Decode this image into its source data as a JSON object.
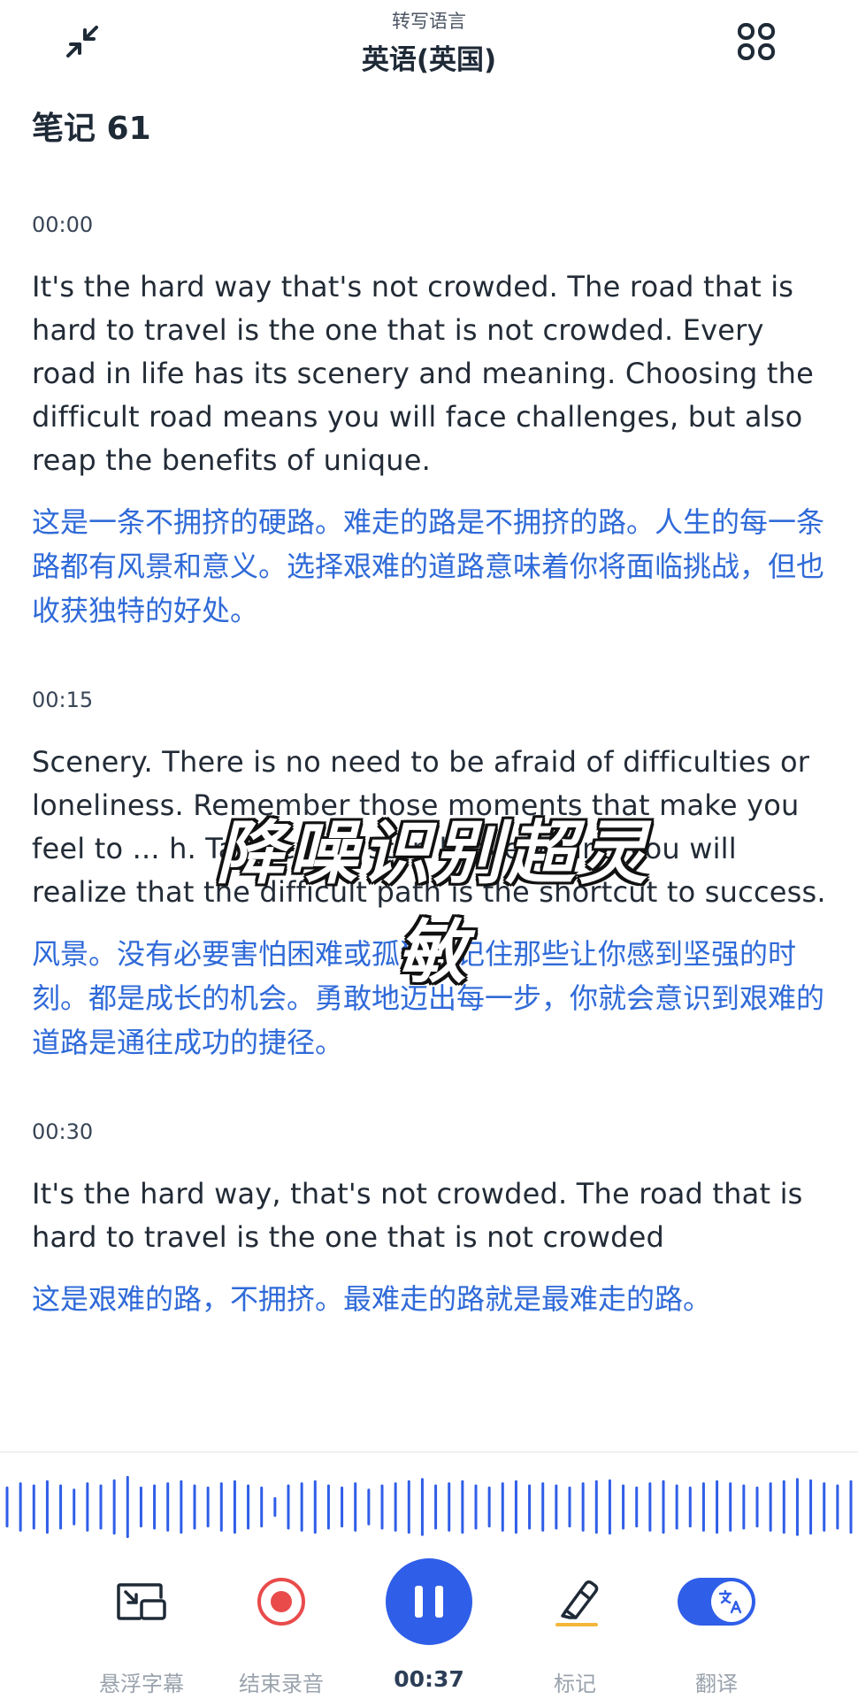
{
  "header": {
    "subtitle": "转写语言",
    "language": "英语(英国)"
  },
  "note": {
    "title": "笔记 61"
  },
  "segments": [
    {
      "time": "00:00",
      "en": "It's the hard way that's not crowded. The road that is hard to travel is the one that is not crowded. Every road in life has its scenery and meaning. Choosing the difficult road means you will face challenges, but also reap the benefits of unique.",
      "zh": "这是一条不拥挤的硬路。难走的路是不拥挤的路。人生的每一条路都有风景和意义。选择艰难的道路意味着你将面临挑战，但也收获独特的好处。"
    },
    {
      "time": "00:15",
      "en": "Scenery. There is no need to be afraid of difficulties or loneliness. Remember those moments that make you feel to ... h. Take every step bravely, and you will realize that the difficult path is the shortcut to success.",
      "zh": "风景。没有必要害怕困难或孤独。记住那些让你感到坚强的时刻。都是成长的机会。勇敢地迈出每一步，你就会意识到艰难的道路是通往成功的捷径。"
    },
    {
      "time": "00:30",
      "en": "It's the hard way, that's not crowded. The road that is hard to travel is the one that is not crowded",
      "zh": "这是艰难的路，不拥挤。最难走的路就是最难走的路。"
    }
  ],
  "overlay": {
    "caption": "降噪识别超灵敏"
  },
  "controls": {
    "floating_subtitles": "悬浮字幕",
    "end_recording": "结束录音",
    "elapsed": "00:37",
    "mark": "标记",
    "translate": "翻译"
  },
  "colors": {
    "accent": "#2f5ee8",
    "translation_text": "#2f6ad8",
    "record_red": "#e94b4b",
    "highlighter_underline": "#f4b63a"
  },
  "waveform": {
    "bar_heights": [
      0.45,
      0.55,
      0.5,
      0.6,
      0.5,
      0.4,
      0.55,
      0.5,
      0.62,
      0.7,
      0.45,
      0.5,
      0.55,
      0.6,
      0.5,
      0.45,
      0.55,
      0.6,
      0.5,
      0.45,
      0.2,
      0.5,
      0.55,
      0.6,
      0.5,
      0.45,
      0.55,
      0.4,
      0.5,
      0.55,
      0.6,
      0.65,
      0.5,
      0.55,
      0.6,
      0.5,
      0.45,
      0.55,
      0.6,
      0.5,
      0.55,
      0.5,
      0.45,
      0.55,
      0.6,
      0.62,
      0.5,
      0.45,
      0.55,
      0.6,
      0.5,
      0.45,
      0.55,
      0.6,
      0.55,
      0.5,
      0.45,
      0.55,
      0.6,
      0.65,
      0.62,
      0.55,
      0.5,
      0.6
    ]
  }
}
